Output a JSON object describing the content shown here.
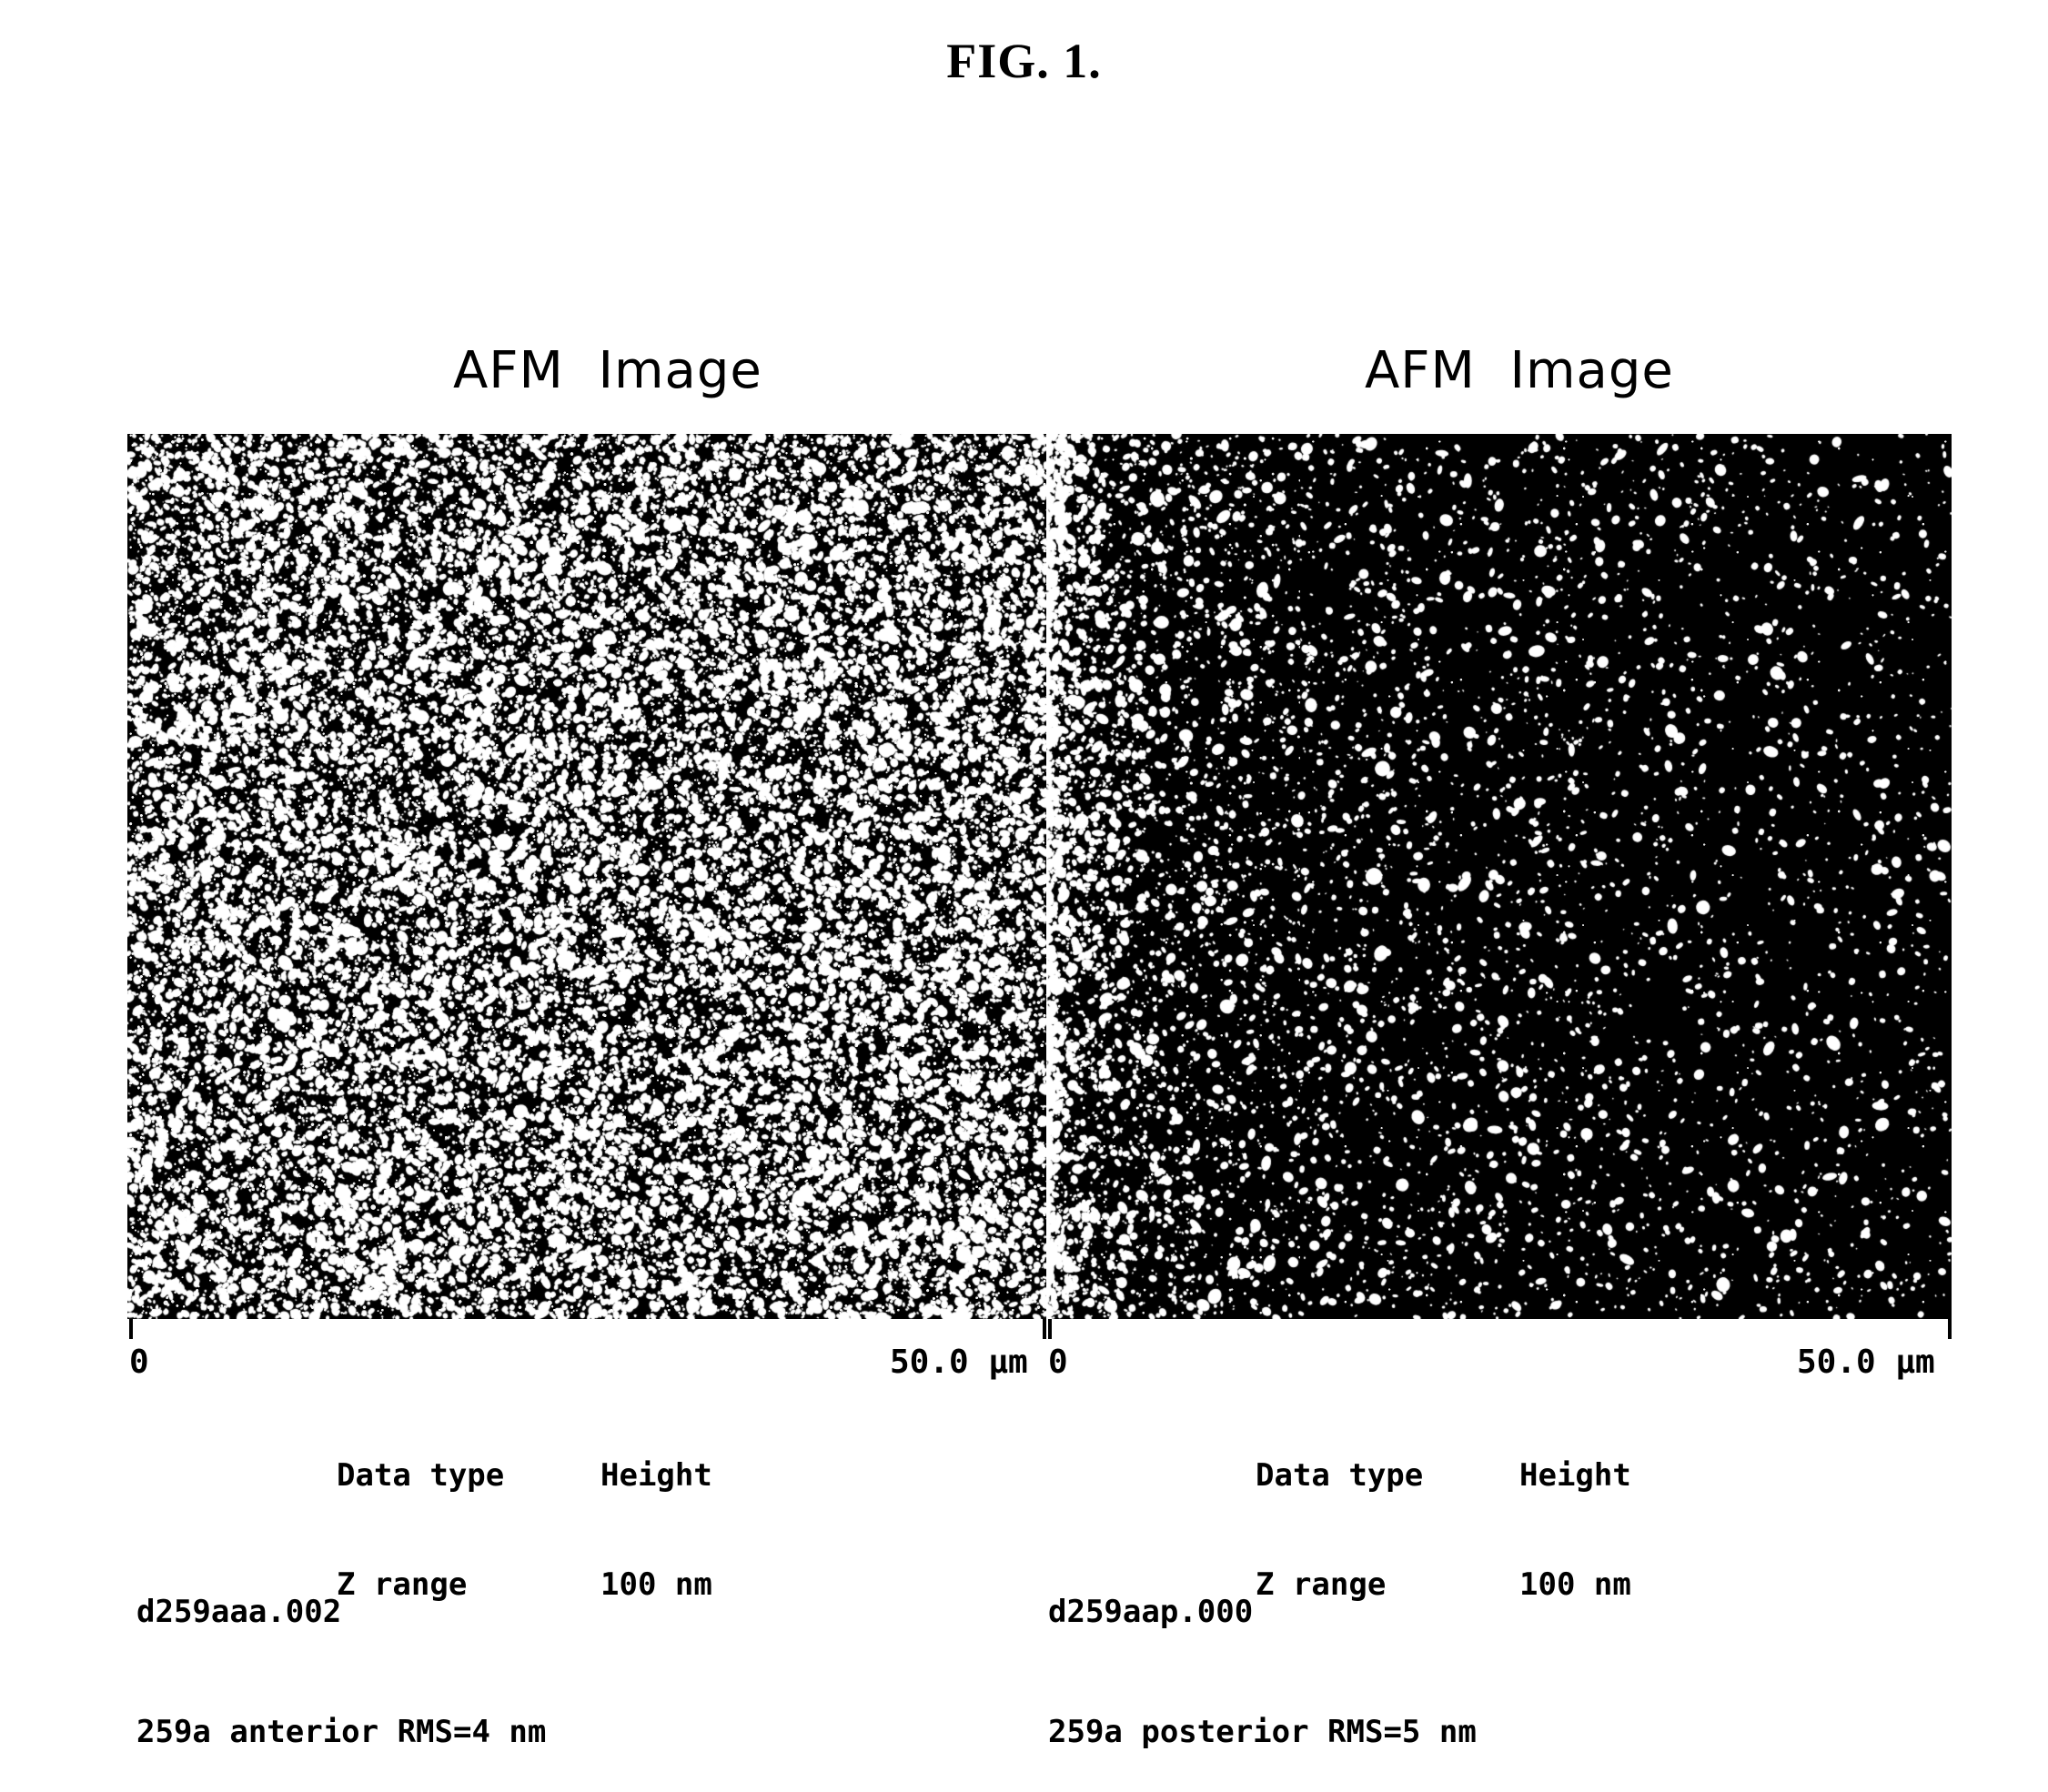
{
  "figure": {
    "title": "FIG. 1."
  },
  "panels": [
    {
      "heading": "AFM  Image",
      "scale": {
        "min_label": "0",
        "max_label": "50.0 µm"
      },
      "params": {
        "data_type_key": "Data type",
        "data_type_value": "Height",
        "z_range_key": "Z range",
        "z_range_value": "100 nm"
      },
      "caption": {
        "filename": "d259aaa.002",
        "description": "259a anterior RMS=4 nm"
      },
      "texture": "dense-speckle"
    },
    {
      "heading": "AFM  Image",
      "scale": {
        "min_label": "0",
        "max_label": "50.0 µm"
      },
      "params": {
        "data_type_key": "Data type",
        "data_type_value": "Height",
        "z_range_key": "Z range",
        "z_range_value": "100 nm"
      },
      "caption": {
        "filename": "d259aap.000",
        "description": "259a posterior RMS=5 nm"
      },
      "texture": "sparse-speckle"
    }
  ],
  "colors": {
    "background": "#ffffff",
    "ink": "#000000",
    "scan_background": "#000000",
    "scan_feature": "#ffffff"
  },
  "chart_data": {
    "type": "heatmap",
    "title": "FIG. 1.",
    "subtitle": "Atomic force microscopy height maps of two specimen surfaces",
    "xlabel": "",
    "ylabel": "",
    "grid": false,
    "legend": "none",
    "panels": [
      {
        "name": "AFM  Image",
        "file": "d259aaa.002",
        "specimen": "259a anterior",
        "data_type": "Height",
        "z_range_nm": 100,
        "rms_roughness_nm": 4,
        "scan_size_um": 50.0,
        "x_axis_ticks": [
          "0",
          "50.0 µm"
        ],
        "xlim_um": [
          0,
          50.0
        ],
        "surface_character": "dense, high-density bright asperities distributed across the full field"
      },
      {
        "name": "AFM  Image",
        "file": "d259aap.000",
        "specimen": "259a posterior",
        "data_type": "Height",
        "z_range_nm": 100,
        "rms_roughness_nm": 5,
        "scan_size_um": 50.0,
        "x_axis_ticks": [
          "0",
          "50.0 µm"
        ],
        "xlim_um": [
          0,
          50.0
        ],
        "surface_character": "sparse bright asperities concentrated toward the left edge, largely smooth elsewhere"
      }
    ]
  }
}
